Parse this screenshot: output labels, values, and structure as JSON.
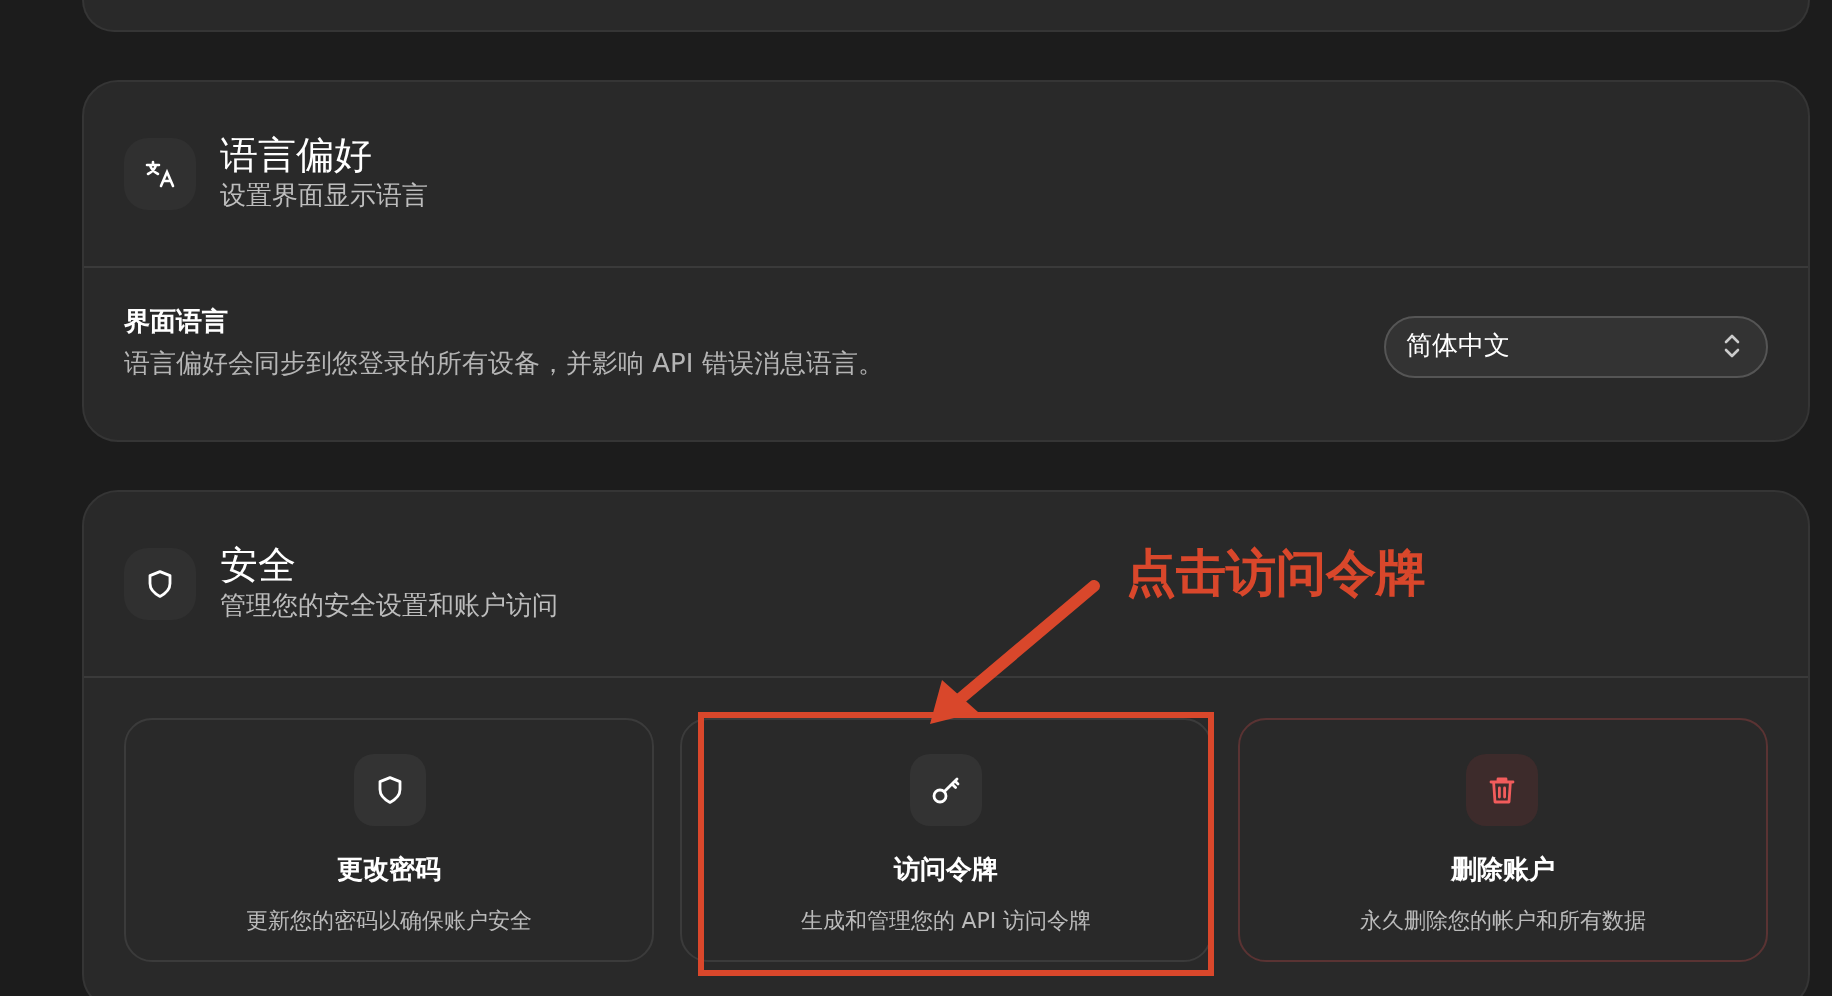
{
  "language_card": {
    "title": "语言偏好",
    "subtitle": "设置界面显示语言",
    "setting": {
      "label": "界面语言",
      "description": "语言偏好会同步到您登录的所有设备，并影响 API 错误消息语言。",
      "value": "简体中文"
    }
  },
  "security_card": {
    "title": "安全",
    "subtitle": "管理您的安全设置和账户访问",
    "tiles": [
      {
        "kind": "password",
        "title": "更改密码",
        "description": "更新您的密码以确保账户安全",
        "danger": false,
        "highlighted": false
      },
      {
        "kind": "token",
        "title": "访问令牌",
        "description": "生成和管理您的 API 访问令牌",
        "danger": false,
        "highlighted": true
      },
      {
        "kind": "delete",
        "title": "删除账户",
        "description": "永久删除您的帐户和所有数据",
        "danger": true,
        "highlighted": false
      }
    ]
  },
  "annotation": {
    "text": "点击访问令牌"
  }
}
